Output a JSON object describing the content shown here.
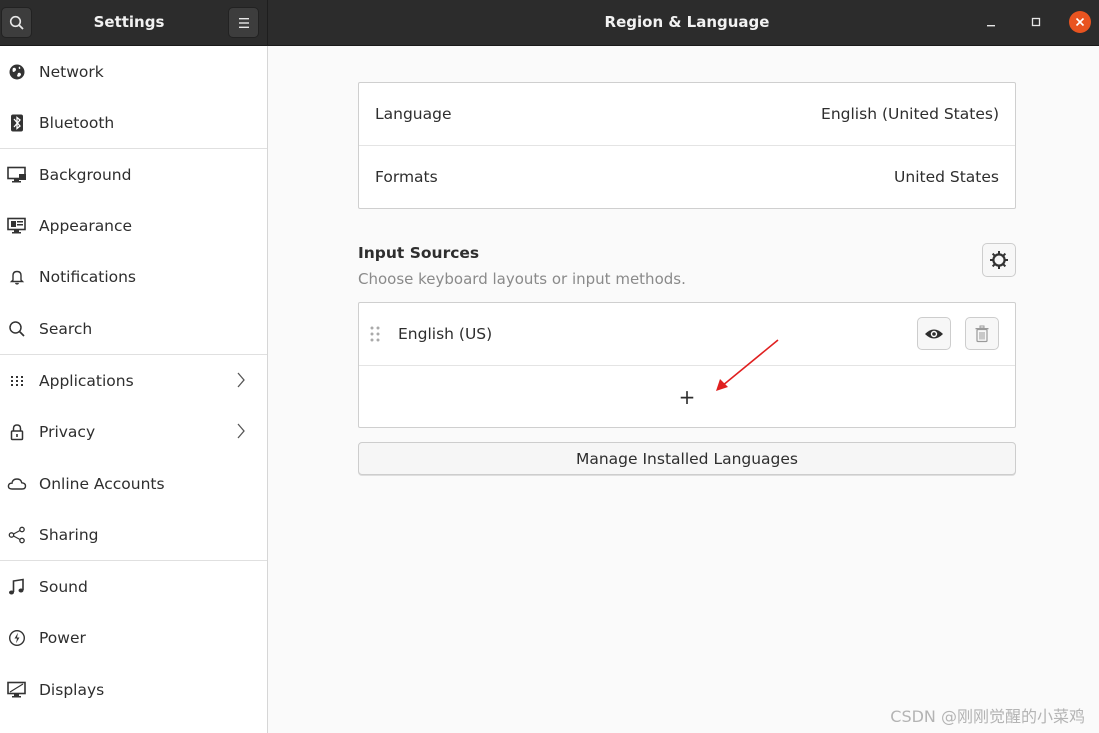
{
  "header": {
    "app_title": "Settings",
    "page_title": "Region & Language",
    "search_icon": "search-icon",
    "menu_icon": "hamburger-icon",
    "window_controls": [
      "minimize",
      "maximize",
      "close"
    ],
    "accent_color": "#e95420"
  },
  "sidebar": {
    "items": [
      {
        "label": "Network",
        "icon": "globe-icon"
      },
      {
        "label": "Bluetooth",
        "icon": "bluetooth-icon"
      },
      {
        "label": "Background",
        "icon": "monitor-icon"
      },
      {
        "label": "Appearance",
        "icon": "appearance-icon"
      },
      {
        "label": "Notifications",
        "icon": "bell-icon"
      },
      {
        "label": "Search",
        "icon": "search-icon"
      },
      {
        "label": "Applications",
        "icon": "grid-icon",
        "chevron": true
      },
      {
        "label": "Privacy",
        "icon": "lock-icon",
        "chevron": true
      },
      {
        "label": "Online Accounts",
        "icon": "cloud-icon"
      },
      {
        "label": "Sharing",
        "icon": "share-icon"
      },
      {
        "label": "Sound",
        "icon": "music-note-icon"
      },
      {
        "label": "Power",
        "icon": "power-icon"
      },
      {
        "label": "Displays",
        "icon": "display-icon"
      }
    ]
  },
  "region": {
    "language_label": "Language",
    "language_value": "English (United States)",
    "formats_label": "Formats",
    "formats_value": "United States"
  },
  "input_sources": {
    "title": "Input Sources",
    "subtitle": "Choose keyboard layouts or input methods.",
    "sources": [
      {
        "label": "English (US)"
      }
    ],
    "add_label": "+",
    "manage_button": "Manage Installed Languages"
  },
  "watermark": "CSDN @刚刚觉醒的小菜鸡",
  "annotation_arrow_color": "#e02020"
}
